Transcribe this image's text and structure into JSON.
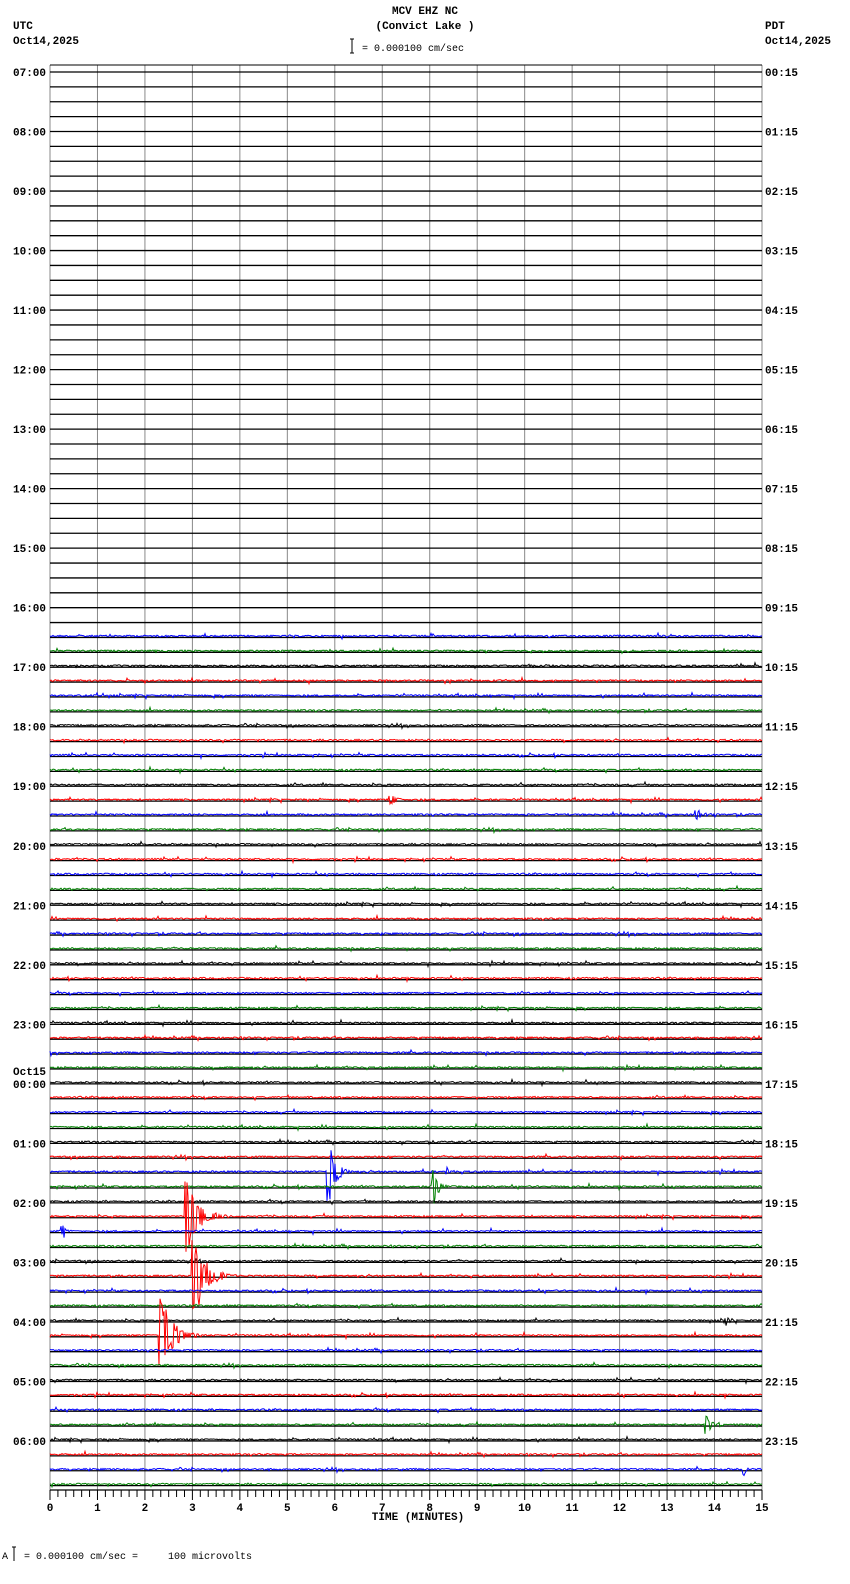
{
  "header": {
    "station": "MCV EHZ NC",
    "location": "(Convict Lake )",
    "scale": "= 0.000100 cm/sec",
    "left_tz": "UTC",
    "left_date": "Oct14,2025",
    "right_tz": "PDT",
    "right_date": "Oct14,2025"
  },
  "footer": {
    "prefix": "A",
    "scale": "= 0.000100 cm/sec =     100 microvolts"
  },
  "colors": {
    "trace_cycle": [
      "#000000",
      "#ff0000",
      "#0000ff",
      "#008000"
    ],
    "grid": "#888888"
  },
  "chart_data": {
    "type": "line",
    "title": "MCV EHZ NC (Convict Lake )",
    "xlabel": "TIME (MINUTES)",
    "xlim": [
      0,
      15
    ],
    "x_ticks": [
      "0",
      "1",
      "2",
      "3",
      "4",
      "5",
      "6",
      "7",
      "8",
      "9",
      "10",
      "11",
      "12",
      "13",
      "14",
      "15"
    ],
    "rows_per_hour": 4,
    "minutes_per_row": 15,
    "utc_labels": [
      "07:00",
      "08:00",
      "09:00",
      "10:00",
      "11:00",
      "12:00",
      "13:00",
      "14:00",
      "15:00",
      "16:00",
      "17:00",
      "18:00",
      "19:00",
      "20:00",
      "21:00",
      "22:00",
      "23:00",
      "00:00",
      "01:00",
      "02:00",
      "03:00",
      "04:00",
      "05:00",
      "06:00"
    ],
    "date_change_label": "Oct15",
    "date_change_before": "00:00",
    "pdt_labels": [
      "00:15",
      "01:15",
      "02:15",
      "03:15",
      "04:15",
      "05:15",
      "06:15",
      "07:15",
      "08:15",
      "09:15",
      "10:15",
      "11:15",
      "12:15",
      "13:15",
      "14:15",
      "15:15",
      "16:15",
      "17:15",
      "18:15",
      "19:15",
      "20:15",
      "21:15",
      "22:15",
      "23:15"
    ],
    "data_start_row": "16:30",
    "events": [
      {
        "row": "19:15",
        "minute": 7.15,
        "amplitude": 6,
        "duration": 0.2
      },
      {
        "row": "19:30",
        "minute": 13.6,
        "amplitude": 5,
        "duration": 0.3
      },
      {
        "row": "01:30",
        "minute": 5.85,
        "amplitude": 30,
        "duration": 0.35
      },
      {
        "row": "01:30",
        "minute": 8.35,
        "amplitude": 5,
        "duration": 0.1
      },
      {
        "row": "01:45",
        "minute": 8.05,
        "amplitude": 18,
        "duration": 0.2
      },
      {
        "row": "02:15",
        "minute": 2.85,
        "amplitude": 36,
        "duration": 0.6
      },
      {
        "row": "02:30",
        "minute": 0.25,
        "amplitude": 6,
        "duration": 0.15
      },
      {
        "row": "03:15",
        "minute": 3.0,
        "amplitude": 46,
        "duration": 0.6
      },
      {
        "row": "04:00",
        "minute": 14.2,
        "amplitude": 6,
        "duration": 0.1
      },
      {
        "row": "04:15",
        "minute": 2.3,
        "amplitude": 42,
        "duration": 0.6
      },
      {
        "row": "05:45",
        "minute": 13.8,
        "amplitude": 9,
        "duration": 0.4
      },
      {
        "row": "06:30",
        "minute": 14.6,
        "amplitude": 6,
        "duration": 0.05
      }
    ]
  }
}
